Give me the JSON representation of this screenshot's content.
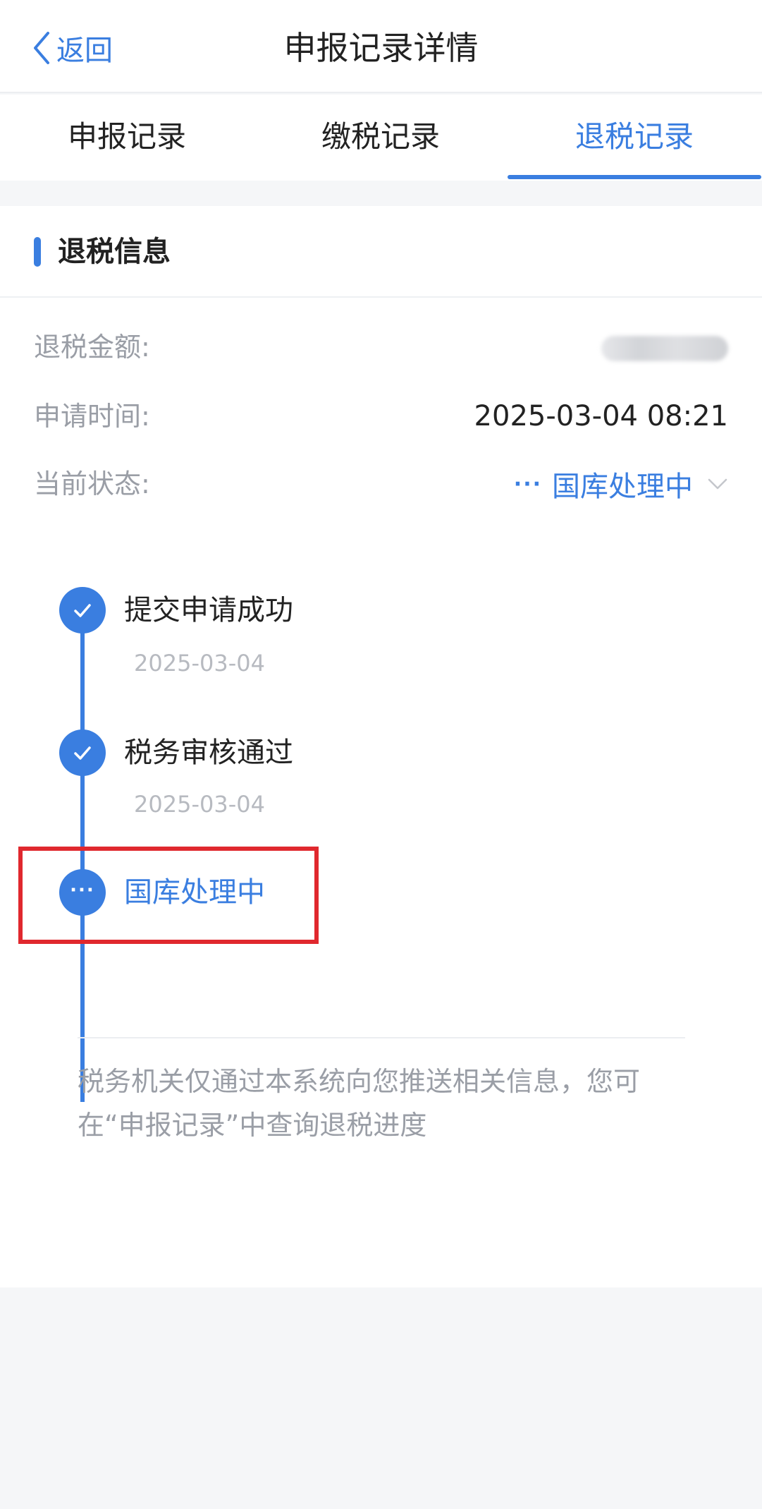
{
  "navbar": {
    "back_label": "返回",
    "title": "申报记录详情"
  },
  "tabs": [
    {
      "label": "申报记录",
      "active": false
    },
    {
      "label": "缴税记录",
      "active": false
    },
    {
      "label": "退税记录",
      "active": true
    }
  ],
  "section": {
    "title": "退税信息"
  },
  "info": {
    "amount_label": "退税金额:",
    "time_label": "申请时间:",
    "time_value": "2025-03-04 08:21",
    "status_label": "当前状态:",
    "status_dots": "···",
    "status_value": "国库处理中"
  },
  "timeline": [
    {
      "title": "提交申请成功",
      "date": "2025-03-04",
      "state": "done"
    },
    {
      "title": "税务审核通过",
      "date": "2025-03-04",
      "state": "done"
    },
    {
      "title": "国库处理中",
      "date": "",
      "state": "in-progress"
    }
  ],
  "notice": "税务机关仅通过本系统向您推送相关信息，您可在“申报记录”中查询退税进度",
  "colors": {
    "accent": "#3a7ee0",
    "highlight": "#e0282e"
  },
  "icons": {
    "back": "chevron-left-icon",
    "status": "chevron-down-icon",
    "done_step": "check-icon",
    "progress_step": "more-dots-icon"
  }
}
